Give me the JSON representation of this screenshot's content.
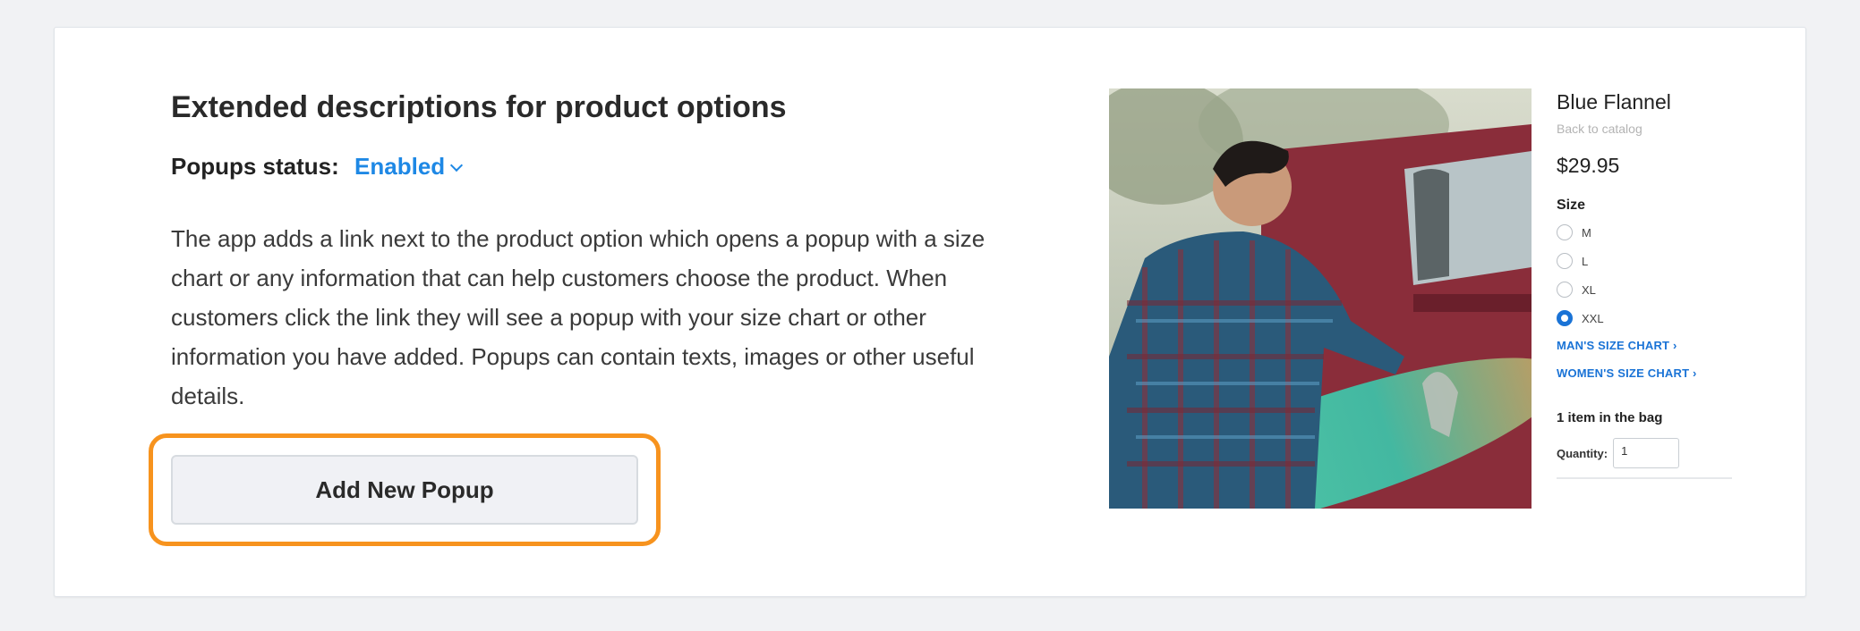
{
  "card": {
    "title": "Extended descriptions for product options",
    "status_label": "Popups status:",
    "status_value": "Enabled",
    "description": "The app adds a link next to the product option which opens a popup with a size chart or any information that can help customers choose the product. When customers click the link they will see a popup with your size chart or other information you have added. Popups can contain texts, images or other useful details.",
    "add_button_label": "Add New Popup"
  },
  "preview": {
    "product_name": "Blue Flannel",
    "back_link": "Back to catalog",
    "price": "$29.95",
    "size_label": "Size",
    "sizes": [
      {
        "label": "M",
        "selected": false
      },
      {
        "label": "L",
        "selected": false
      },
      {
        "label": "XL",
        "selected": false
      },
      {
        "label": "XXL",
        "selected": true
      }
    ],
    "mans_chart_link": "MAN'S SIZE CHART ›",
    "womens_chart_link": "WOMEN'S SIZE CHART ›",
    "bag_text": "1 item in the bag",
    "quantity_label": "Quantity:",
    "quantity_value": "1"
  },
  "colors": {
    "accent": "#1e88e5",
    "highlight": "#f7931e",
    "button_bg": "#f0f1f5"
  }
}
